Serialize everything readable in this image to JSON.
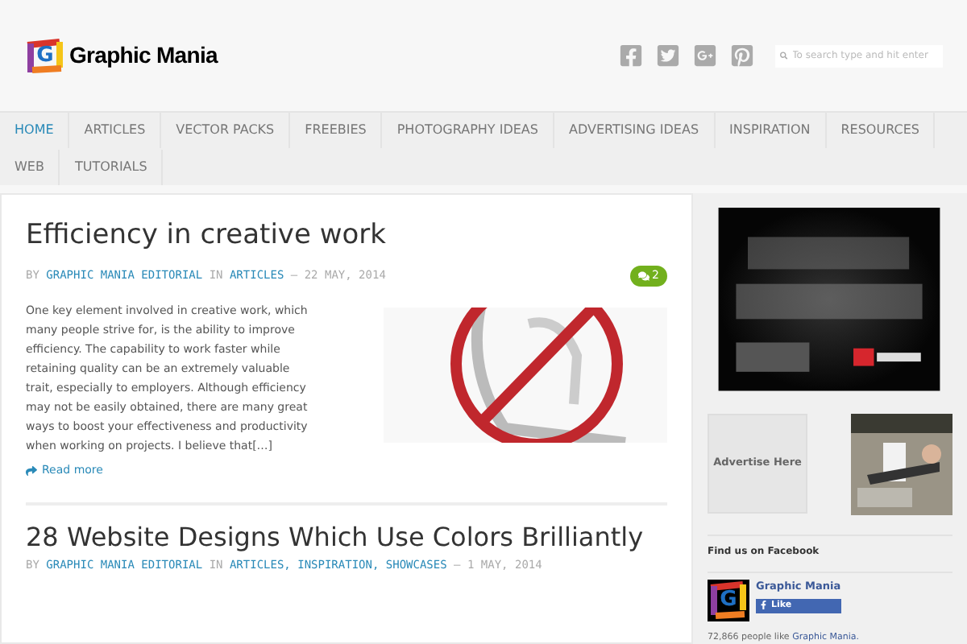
{
  "header": {
    "logo_mark": "G",
    "logo_text": "Graphic Mania",
    "search": {
      "placeholder": "To search type and hit enter"
    }
  },
  "nav": [
    {
      "label": "HOME",
      "selected": true
    },
    {
      "label": "ARTICLES",
      "selected": false
    },
    {
      "label": "VECTOR PACKS",
      "selected": false
    },
    {
      "label": "FREEBIES",
      "selected": false
    },
    {
      "label": "PHOTOGRAPHY IDEAS",
      "selected": false
    },
    {
      "label": "ADVERTISING IDEAS",
      "selected": false
    },
    {
      "label": "INSPIRATION",
      "selected": false
    },
    {
      "label": "RESOURCES",
      "selected": false
    },
    {
      "label": "WEB",
      "selected": false
    },
    {
      "label": "TUTORIALS",
      "selected": false
    }
  ],
  "posts": [
    {
      "title": "Efficiency in creative work",
      "by": "BY",
      "author": "GRAPHIC MANIA EDITORIAL",
      "in": "IN",
      "categories": "ARTICLES",
      "date": "— 22 MAY, 2014",
      "comments": "2",
      "excerpt": "One key element involved in creative work, which many people strive for, is the ability to improve efficiency. The capability to work faster while retaining quality can be an extremely valuable trait, especially to employers. Although efficiency may not be easily obtained, there are many great ways to boost your effectiveness and productivity when working on projects. I believe that[…]",
      "read_more": "Read more"
    },
    {
      "title": "28 Website Designs Which Use Colors Brilliantly",
      "by": "BY",
      "author": "GRAPHIC MANIA EDITORIAL",
      "in": "IN",
      "categories": "ARTICLES, INSPIRATION, SHOWCASES",
      "date": "— 1 MAY, 2014"
    }
  ],
  "sidebar": {
    "advertise": "Advertise Here",
    "facebook": {
      "heading": "Find us on Facebook",
      "logo_mark": "G",
      "page_name": "Graphic Mania",
      "like": "Like",
      "count": "72,866 people like",
      "count_link": "Graphic Mania."
    }
  }
}
